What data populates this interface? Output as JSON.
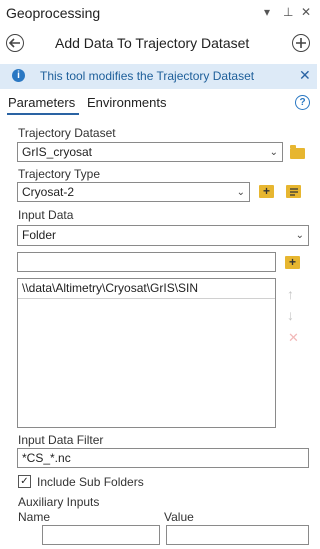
{
  "window": {
    "title": "Geoprocessing",
    "controls": {
      "menu": "▾",
      "pin": "⊥",
      "close": "✕"
    }
  },
  "header": {
    "back_icon": "arrow-left-circle-icon",
    "title": "Add Data To Trajectory Dataset",
    "add_icon": "plus-circle-icon"
  },
  "info_bar": {
    "icon": "i",
    "message": "This tool modifies the Trajectory Dataset",
    "close": "✕"
  },
  "tabs": [
    {
      "label": "Parameters",
      "active": true
    },
    {
      "label": "Environments",
      "active": false
    }
  ],
  "help": "?",
  "params": {
    "trajectory_dataset": {
      "label": "Trajectory Dataset",
      "value": "GrIS_cryosat"
    },
    "trajectory_type": {
      "label": "Trajectory Type",
      "value": "Cryosat-2"
    },
    "input_data": {
      "label": "Input Data",
      "type_value": "Folder",
      "new_value": "",
      "items": [
        "\\\\data\\Altimetry\\Cryosat\\GrIS\\SIN"
      ]
    },
    "input_data_filter": {
      "label": "Input Data Filter",
      "value": "*CS_*.nc"
    },
    "include_sub_folders": {
      "label": "Include Sub Folders",
      "checked": true
    },
    "auxiliary_inputs": {
      "label": "Auxiliary Inputs",
      "col_name": "Name",
      "col_value": "Value",
      "name_value": "",
      "value_value": ""
    }
  },
  "glyphs": {
    "dropdown": "⌄",
    "check": "✓",
    "up": "↑",
    "down": "↓",
    "remove": "✕"
  },
  "colors": {
    "accent": "#2a63a3",
    "info_bg": "#ddeaf7",
    "folder": "#e7b630"
  }
}
